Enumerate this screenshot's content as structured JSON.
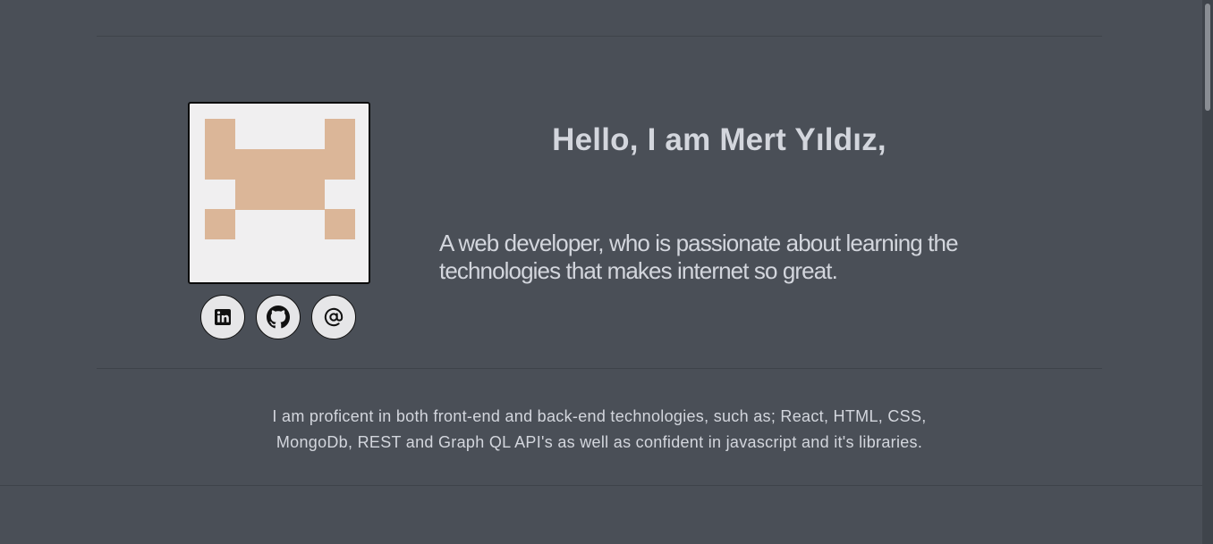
{
  "hero": {
    "greeting": "Hello, I am Mert Yıldız,",
    "tagline_line1": "A web developer, who is passionate about learning the",
    "tagline_line2": "technologies that makes internet so great."
  },
  "avatar": {
    "kind": "pixel-art identicon",
    "color": "#dbb698",
    "background": "#f0eff0"
  },
  "social_links": [
    {
      "name": "linkedin",
      "icon": "linkedin-icon"
    },
    {
      "name": "github",
      "icon": "github-icon"
    },
    {
      "name": "email",
      "icon": "at-sign-icon"
    }
  ],
  "about": {
    "line1": "I am proficent in both front-end and back-end technologies, such as; React, HTML, CSS,",
    "line2": "MongoDb, REST and Graph QL API's as well as confident in javascript and it's libraries."
  },
  "colors": {
    "background": "#4a4f57",
    "text": "#d3d6dd",
    "button": "#e6e6e8"
  }
}
